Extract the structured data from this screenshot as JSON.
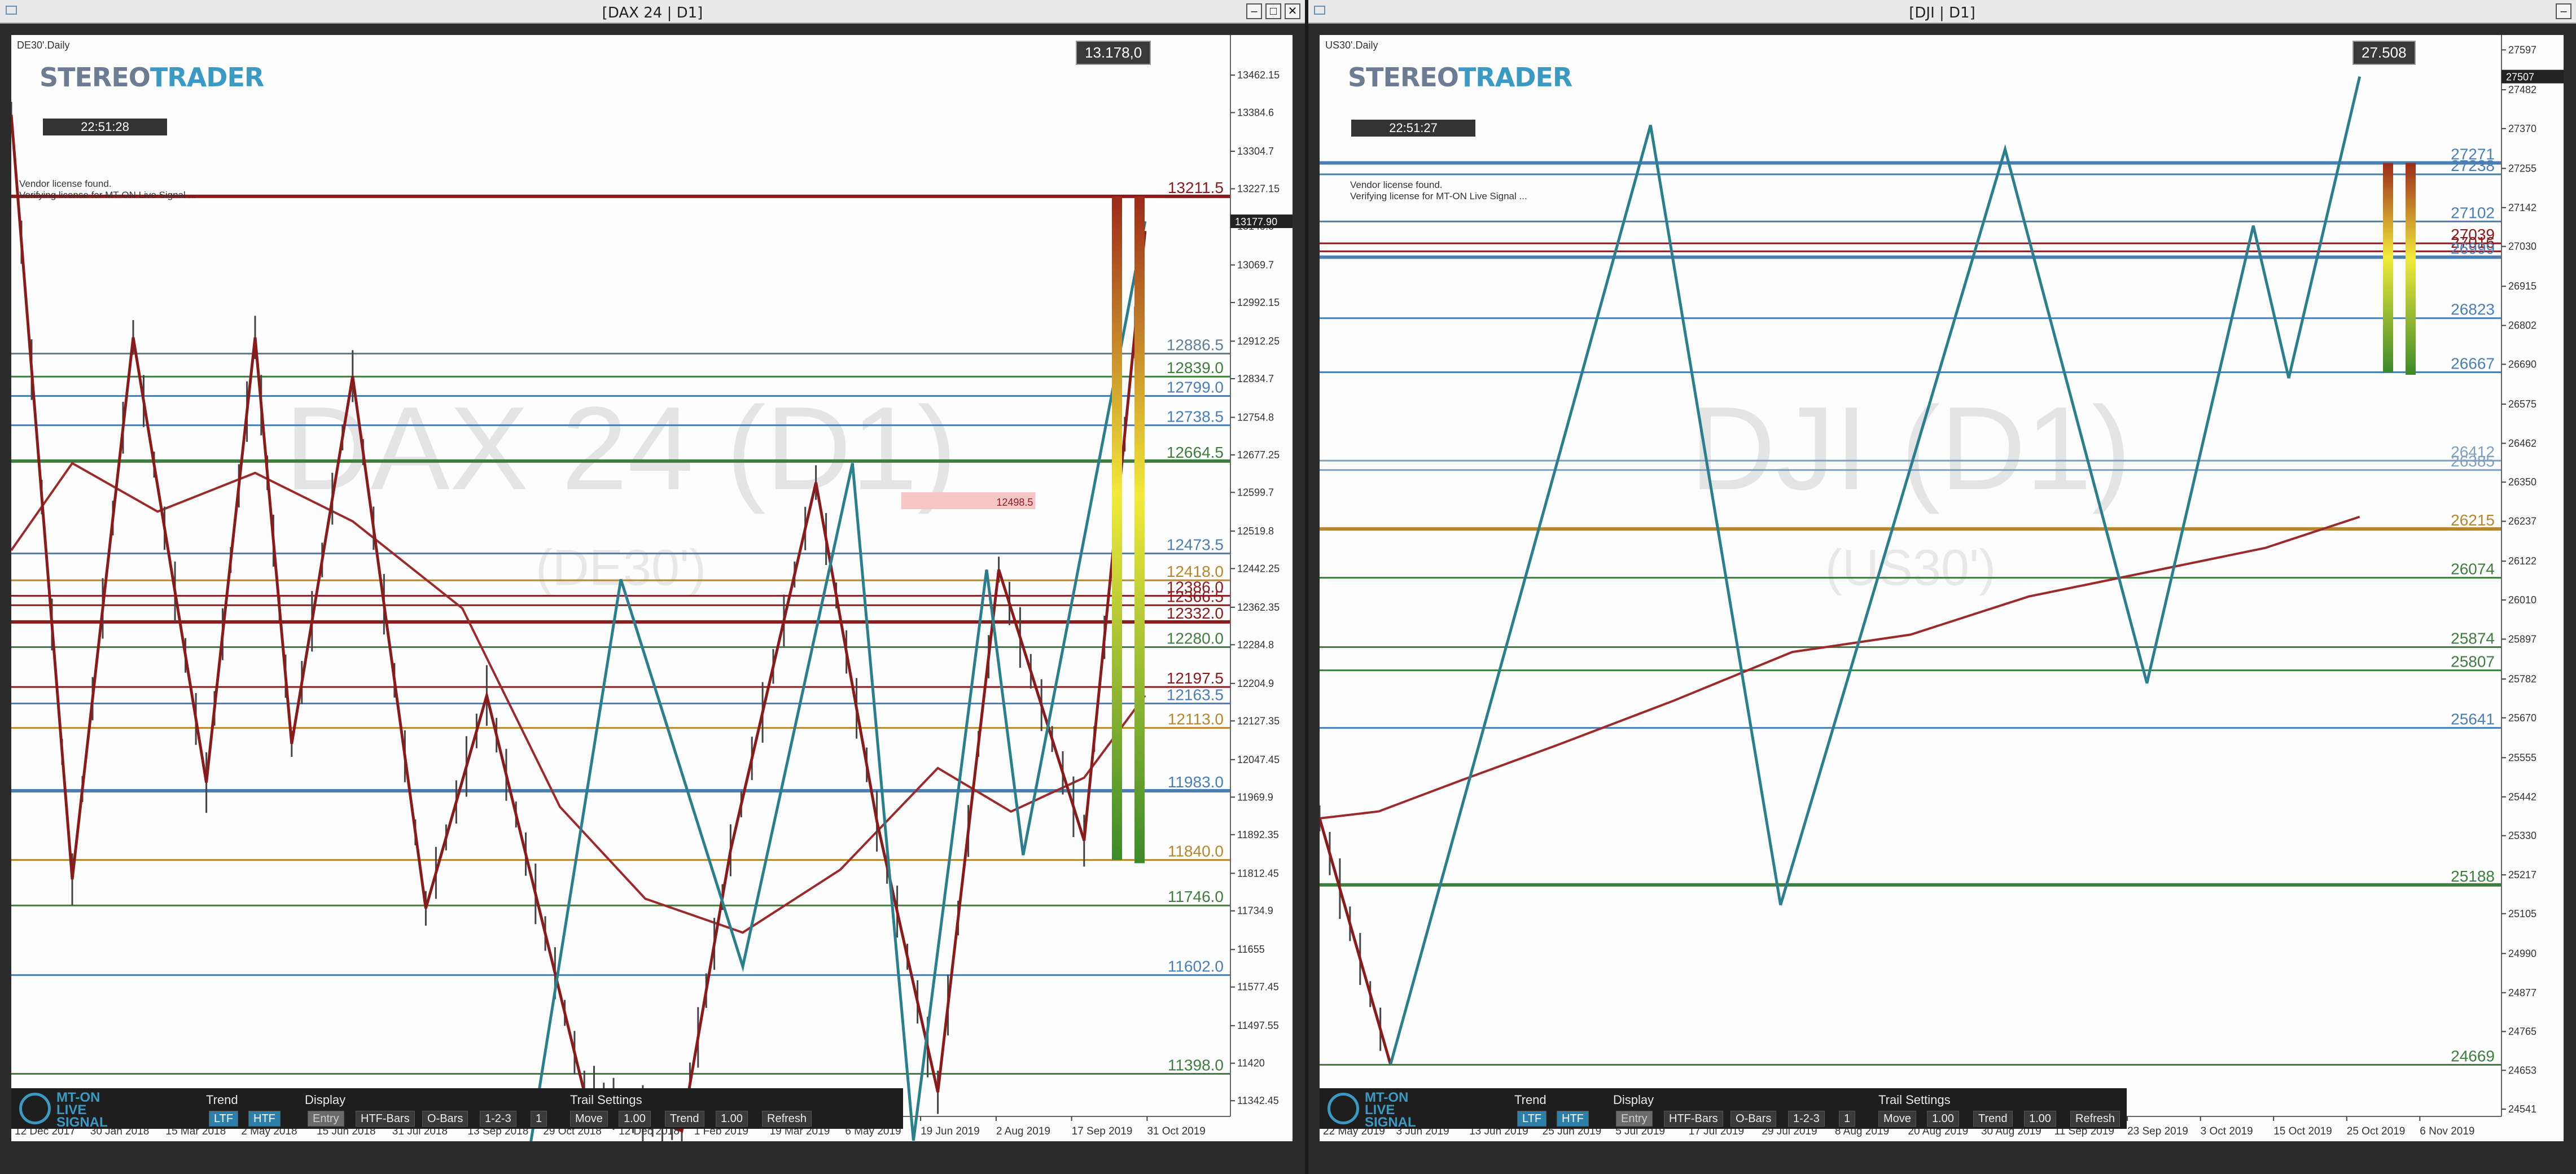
{
  "windows": [
    {
      "title": "[DAX 24 | D1]",
      "chart_id": "DE30'.Daily",
      "logo": "STEREOTRADER",
      "clock": "22:51:28",
      "price_box": "13.178,0",
      "license_lines": [
        "Vendor license found.",
        "Verifying license for MT-ON Live Signal ..."
      ],
      "watermark": "DAX 24 (D1)",
      "watermark_sub": "(DE30')",
      "current_price_label": "13177.90",
      "colors": {
        "up": "#8b1a1a",
        "leg": "#2a7f8f",
        "ma": "#9c2a2a",
        "bg": "#fdfdfd"
      }
    },
    {
      "title": "[DJI | D1]",
      "chart_id": "US30'.Daily",
      "logo": "STEREOTRADER",
      "clock": "22:51:27",
      "price_box": "27.508",
      "license_lines": [
        "Vendor license found.",
        "Verifying license for MT-ON Live Signal ..."
      ],
      "watermark": "DJI (D1)",
      "watermark_sub": "(US30')",
      "current_price_label": "27507",
      "colors": {
        "up": "#8b1a1a",
        "leg": "#2a7f8f",
        "ma": "#9c2a2a",
        "bg": "#fdfdfd"
      }
    }
  ],
  "panel": {
    "brand_lines": [
      "MT-ON",
      "LIVE",
      "SIGNAL"
    ],
    "trend_label": "Trend",
    "trend_buttons": [
      "LTF",
      "HTF"
    ],
    "display_label": "Display",
    "display_buttons": [
      "Entry",
      "HTF-Bars",
      "O-Bars",
      "1-2-3",
      "1"
    ],
    "trail_label": "Trail Settings",
    "trail_buttons": [
      "Move",
      "1.00",
      "Trend",
      "1.00",
      "Refresh"
    ]
  },
  "chart_data": [
    {
      "type": "line",
      "title": "[DAX 24 | D1]",
      "x_ticks": [
        "12 Dec 2017",
        "30 Jan 2018",
        "15 Mar 2018",
        "2 May 2018",
        "15 Jun 2018",
        "31 Jul 2018",
        "13 Sep 2018",
        "29 Oct 2018",
        "12 Dec 2018",
        "1 Feb 2019",
        "19 Mar 2019",
        "6 May 2019",
        "19 Jun 2019",
        "2 Aug 2019",
        "17 Sep 2019",
        "31 Oct 2019"
      ],
      "y_ticks": [
        13462.15,
        13384.6,
        13304.7,
        13227.15,
        13149.6,
        13069.7,
        12992.15,
        12912.25,
        12834.7,
        12754.8,
        12677.25,
        12599.7,
        12519.8,
        12442.25,
        12362.35,
        12284.8,
        12204.9,
        12127.35,
        12047.45,
        11969.9,
        11892.35,
        11812.45,
        11734.9,
        11655.0,
        11577.45,
        11497.55,
        11420.0,
        11342.45
      ],
      "ylim": [
        11310,
        13545
      ],
      "levels": [
        {
          "value": 13211.5,
          "label": "13211.5",
          "color": "#8b1a1a"
        },
        {
          "value": 12886.5,
          "label": "12886.5",
          "color": "#5f7f99"
        },
        {
          "value": 12839.0,
          "label": "12839.0",
          "color": "#3f7d3f"
        },
        {
          "value": 12799.0,
          "label": "12799.0",
          "color": "#4a7fb5"
        },
        {
          "value": 12738.5,
          "label": "12738.5",
          "color": "#4a7fb5"
        },
        {
          "value": 12664.5,
          "label": "12664.5",
          "color": "#3f7d3f"
        },
        {
          "value": 12473.5,
          "label": "12473.5",
          "color": "#4a7fb5"
        },
        {
          "value": 12418.0,
          "label": "12418.0",
          "color": "#b8862a"
        },
        {
          "value": 12386.0,
          "label": "12386.0",
          "color": "#8b1a1a"
        },
        {
          "value": 12366.5,
          "label": "12366.5",
          "color": "#8b1a1a"
        },
        {
          "value": 12332.0,
          "label": "12332.0",
          "color": "#8b1a1a"
        },
        {
          "value": 12280.0,
          "label": "12280.0",
          "color": "#3f7d3f"
        },
        {
          "value": 12197.5,
          "label": "12197.5",
          "color": "#8b1a1a"
        },
        {
          "value": 12163.5,
          "label": "12163.5",
          "color": "#4a7fb5"
        },
        {
          "value": 12113.0,
          "label": "12113.0",
          "color": "#b8862a"
        },
        {
          "value": 11983.0,
          "label": "11983.0",
          "color": "#4a7fb5"
        },
        {
          "value": 11840.0,
          "label": "11840.0",
          "color": "#b8862a"
        },
        {
          "value": 11746.0,
          "label": "11746.0",
          "color": "#3f7d3f"
        },
        {
          "value": 11602.0,
          "label": "11602.0",
          "color": "#4a7fb5"
        },
        {
          "value": 11398.0,
          "label": "11398.0",
          "color": "#3f7d3f"
        }
      ],
      "zone": {
        "label": "12498.5",
        "top": 12600,
        "bottom": 12565
      },
      "zigzag_up": [
        [
          0,
          13380
        ],
        [
          0.05,
          11800
        ],
        [
          0.1,
          12920
        ],
        [
          0.16,
          12000
        ],
        [
          0.2,
          12920
        ],
        [
          0.23,
          12080
        ],
        [
          0.28,
          12840
        ],
        [
          0.34,
          11740
        ],
        [
          0.39,
          12180
        ],
        [
          0.47,
          11360
        ],
        [
          0.55,
          11280
        ],
        [
          0.59,
          11860
        ],
        [
          0.66,
          12620
        ],
        [
          0.71,
          11920
        ],
        [
          0.76,
          11360
        ],
        [
          0.81,
          12440
        ],
        [
          0.88,
          11880
        ],
        [
          0.93,
          13140
        ]
      ],
      "zigzag_leg": [
        [
          0.42,
          11160
        ],
        [
          0.5,
          12420
        ],
        [
          0.6,
          11620
        ],
        [
          0.69,
          12660
        ],
        [
          0.74,
          11260
        ],
        [
          0.8,
          12440
        ],
        [
          0.83,
          11850
        ],
        [
          0.93,
          13160
        ]
      ],
      "ma": [
        [
          0.0,
          12480
        ],
        [
          0.05,
          12660
        ],
        [
          0.12,
          12560
        ],
        [
          0.2,
          12640
        ],
        [
          0.28,
          12540
        ],
        [
          0.37,
          12360
        ],
        [
          0.45,
          11950
        ],
        [
          0.52,
          11760
        ],
        [
          0.6,
          11690
        ],
        [
          0.68,
          11820
        ],
        [
          0.76,
          12030
        ],
        [
          0.82,
          11940
        ],
        [
          0.88,
          12010
        ],
        [
          0.93,
          12180
        ]
      ]
    },
    {
      "type": "line",
      "title": "[DJI | D1]",
      "x_ticks": [
        "22 May 2019",
        "3 Jun 2019",
        "13 Jun 2019",
        "25 Jun 2019",
        "5 Jul 2019",
        "17 Jul 2019",
        "29 Jul 2019",
        "8 Aug 2019",
        "20 Aug 2019",
        "30 Aug 2019",
        "11 Sep 2019",
        "23 Sep 2019",
        "3 Oct 2019",
        "15 Oct 2019",
        "25 Oct 2019",
        "6 Nov 2019"
      ],
      "y_ticks": [
        27597,
        27482,
        27370,
        27255,
        27142,
        27030,
        26915,
        26802,
        26690,
        26575,
        26462,
        26350,
        26237,
        26122,
        26010,
        25897,
        25782,
        25670,
        25555,
        25442,
        25330,
        25217,
        25105,
        24990,
        24877,
        24765,
        24653,
        24541
      ],
      "ylim": [
        24520,
        27640
      ],
      "levels": [
        {
          "value": 27271,
          "label": "27271",
          "color": "#4a7fb5"
        },
        {
          "value": 27238,
          "label": "27238",
          "color": "#4a7fb5"
        },
        {
          "value": 27102,
          "label": "27102",
          "color": "#4a7fb5"
        },
        {
          "value": 27039,
          "label": "27039",
          "color": "#8b1a1a"
        },
        {
          "value": 27016,
          "label": "27016",
          "color": "#8b1a1a"
        },
        {
          "value": 26999,
          "label": "26999",
          "color": "#4a7fb5"
        },
        {
          "value": 26823,
          "label": "26823",
          "color": "#4a7fb5"
        },
        {
          "value": 26667,
          "label": "26667",
          "color": "#4a7fb5"
        },
        {
          "value": 26412,
          "label": "26412",
          "color": "#7f9fbf"
        },
        {
          "value": 26385,
          "label": "26385",
          "color": "#7f9fbf"
        },
        {
          "value": 26215,
          "label": "26215",
          "color": "#b8862a"
        },
        {
          "value": 26074,
          "label": "26074",
          "color": "#3f7d3f"
        },
        {
          "value": 25874,
          "label": "25874",
          "color": "#3f7d3f"
        },
        {
          "value": 25807,
          "label": "25807",
          "color": "#3f7d3f"
        },
        {
          "value": 25641,
          "label": "25641",
          "color": "#4a7fb5"
        },
        {
          "value": 25188,
          "label": "25188",
          "color": "#3f7d3f"
        },
        {
          "value": 24669,
          "label": "24669",
          "color": "#3f7d3f"
        }
      ],
      "zigzag_up": [
        [
          0,
          25380
        ],
        [
          0.06,
          24670
        ]
      ],
      "zigzag_leg": [
        [
          0.06,
          24670
        ],
        [
          0.28,
          27380
        ],
        [
          0.39,
          25130
        ],
        [
          0.58,
          27310
        ],
        [
          0.7,
          25770
        ],
        [
          0.79,
          27090
        ],
        [
          0.82,
          26650
        ],
        [
          0.88,
          27520
        ]
      ],
      "ma": [
        [
          0.0,
          25380
        ],
        [
          0.05,
          25400
        ],
        [
          0.12,
          25490
        ],
        [
          0.2,
          25590
        ],
        [
          0.3,
          25720
        ],
        [
          0.4,
          25860
        ],
        [
          0.5,
          25910
        ],
        [
          0.6,
          26020
        ],
        [
          0.7,
          26090
        ],
        [
          0.8,
          26160
        ],
        [
          0.88,
          26250
        ]
      ]
    }
  ]
}
